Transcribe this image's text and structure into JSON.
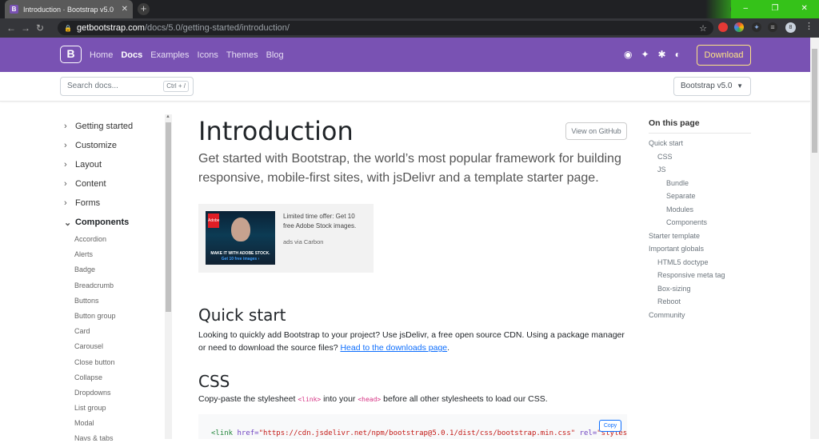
{
  "browser": {
    "tab_title": "Introduction · Bootstrap v5.0",
    "tab_favicon": "B",
    "new_tab": "+",
    "url_host": "getbootstrap.com",
    "url_path": "/docs/5.0/getting-started/introduction/",
    "window_controls": [
      "–",
      "❐",
      "✕"
    ],
    "profile_initial": "8"
  },
  "navbar": {
    "logo": "B",
    "links": [
      "Home",
      "Docs",
      "Examples",
      "Icons",
      "Themes",
      "Blog"
    ],
    "active_link": "Docs",
    "download": "Download",
    "brand_color": "#7952b3"
  },
  "subnav": {
    "search_placeholder": "Search docs...",
    "search_shortcut": "Ctrl + /",
    "version": "Bootstrap v5.0"
  },
  "sidebar": {
    "groups": [
      "Getting started",
      "Customize",
      "Layout",
      "Content",
      "Forms",
      "Components"
    ],
    "open_group": "Components",
    "components": [
      "Accordion",
      "Alerts",
      "Badge",
      "Breadcrumb",
      "Buttons",
      "Button group",
      "Card",
      "Carousel",
      "Close button",
      "Collapse",
      "Dropdowns",
      "List group",
      "Modal",
      "Navs & tabs"
    ]
  },
  "main": {
    "title": "Introduction",
    "view_github": "View on GitHub",
    "lead": "Get started with Bootstrap, the world’s most popular framework for building responsive, mobile-first sites, with jsDelivr and a template starter page.",
    "ad": {
      "text": "Limited time offer: Get 10 free Adobe Stock images.",
      "via": "ads via Carbon",
      "image_logo": "Adobe",
      "image_caption": "MAKE IT WITH ADOBE STOCK.",
      "image_caption2": "Get 10 free images ›"
    },
    "quick_start": {
      "heading": "Quick start",
      "text": "Looking to quickly add Bootstrap to your project? Use jsDelivr, a free open source CDN. Using a package manager or need to download the source files? ",
      "link": "Head to the downloads page",
      "end": "."
    },
    "css": {
      "heading": "CSS",
      "text_before": "Copy-paste the stylesheet ",
      "code1": "<link>",
      "text_mid": " into your ",
      "code2": "<head>",
      "text_after": " before all other stylesheets to load our CSS.",
      "copy": "Copy",
      "code_tag": "<link",
      "code_href_attr": " href=",
      "code_href_val": "\"https://cdn.jsdelivr.net/npm/bootstrap@5.0.1/dist/css/bootstrap.min.css\"",
      "code_rel_attr": " rel=",
      "code_rel_val": "\"stylesheet\""
    }
  },
  "toc": {
    "heading": "On this page",
    "items": [
      {
        "label": "Quick start",
        "level": 0
      },
      {
        "label": "CSS",
        "level": 1
      },
      {
        "label": "JS",
        "level": 1
      },
      {
        "label": "Bundle",
        "level": 2
      },
      {
        "label": "Separate",
        "level": 2
      },
      {
        "label": "Modules",
        "level": 2
      },
      {
        "label": "Components",
        "level": 2
      },
      {
        "label": "Starter template",
        "level": 0
      },
      {
        "label": "Important globals",
        "level": 0
      },
      {
        "label": "HTML5 doctype",
        "level": 1
      },
      {
        "label": "Responsive meta tag",
        "level": 1
      },
      {
        "label": "Box-sizing",
        "level": 1
      },
      {
        "label": "Reboot",
        "level": 1
      },
      {
        "label": "Community",
        "level": 0
      }
    ]
  }
}
